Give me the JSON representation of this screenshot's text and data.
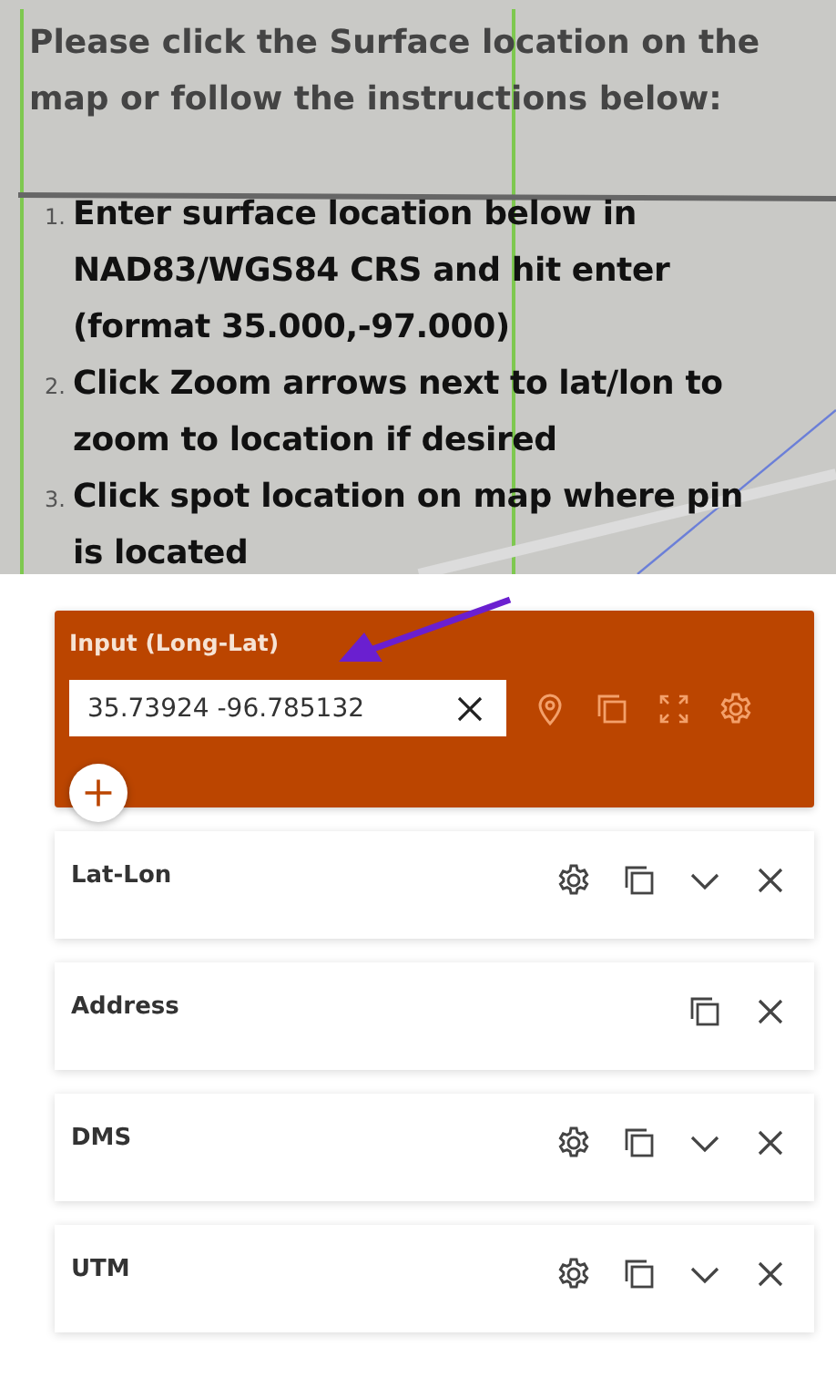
{
  "instructions": {
    "heading": "Please click the Surface location on the map or follow the instructions below:",
    "steps": [
      {
        "number": "1.",
        "text": "Enter surface location below in NAD83/WGS84 CRS and hit enter (format 35.000,-97.000)"
      },
      {
        "number": "2.",
        "text": "Click Zoom arrows next to lat/lon to zoom to location if desired"
      },
      {
        "number": "3.",
        "text": "Click spot location on map where pin is located"
      }
    ]
  },
  "input_card": {
    "title": "Input (Long-Lat)",
    "value": "35.73924 -96.785132",
    "actions": [
      {
        "kind": "pin"
      },
      {
        "kind": "copy"
      },
      {
        "kind": "expand"
      },
      {
        "kind": "settings"
      }
    ]
  },
  "formats": [
    {
      "title": "Lat-Lon",
      "actions": [
        {
          "kind": "settings"
        },
        {
          "kind": "copy"
        },
        {
          "kind": "chevron"
        },
        {
          "kind": "close"
        }
      ]
    },
    {
      "title": "Address",
      "actions": [
        {
          "kind": "copy"
        },
        {
          "kind": "close"
        }
      ]
    },
    {
      "title": "DMS",
      "actions": [
        {
          "kind": "settings"
        },
        {
          "kind": "copy"
        },
        {
          "kind": "chevron"
        },
        {
          "kind": "close"
        }
      ]
    },
    {
      "title": "UTM",
      "actions": [
        {
          "kind": "settings"
        },
        {
          "kind": "copy"
        },
        {
          "kind": "chevron"
        },
        {
          "kind": "close"
        }
      ]
    }
  ]
}
